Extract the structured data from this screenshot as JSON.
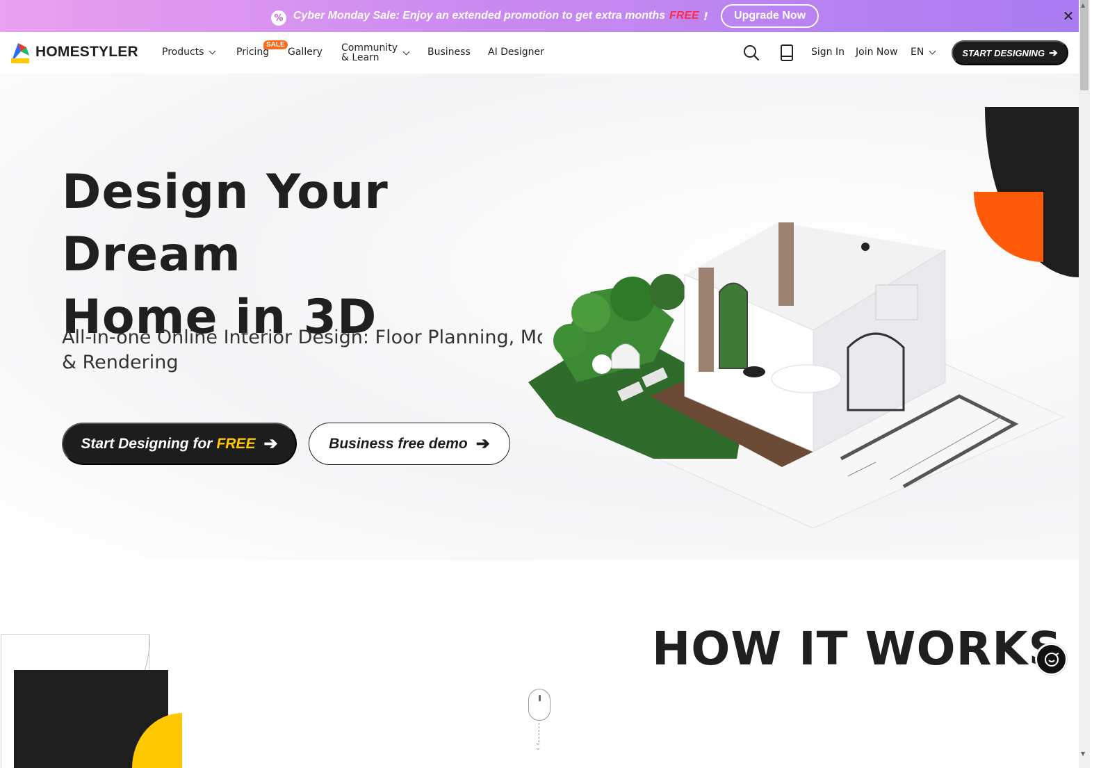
{
  "promo": {
    "icon": "percent-badge-icon",
    "text": "Cyber Monday Sale: Enjoy an extended promotion to get extra months",
    "highlight": "FREE",
    "suffix": "!",
    "button": "Upgrade Now",
    "close_icon": "close-icon"
  },
  "nav": {
    "logo_text": "HOMESTYLER",
    "products": "Products",
    "pricing": "Pricing",
    "sale_badge": "SALE",
    "gallery": "Gallery",
    "community_line1": "Community",
    "community_line2": "& Learn",
    "business": "Business",
    "ai_designer": "AI Designer",
    "sign_in": "Sign In",
    "join_now": "Join Now",
    "language": "EN",
    "start_button": "START DESIGNING"
  },
  "hero": {
    "title_line1": "Design Your Dream",
    "title_line2": "Home in 3D",
    "subtitle_line1": "All-in-one Online Interior Design: Floor Planning, Modeling",
    "subtitle_line2": "& Rendering",
    "cta_primary": "Start Designing for",
    "cta_primary_highlight": "FREE",
    "cta_secondary": "Business free demo"
  },
  "section": {
    "how_it_works": "HOW IT WORKS"
  },
  "colors": {
    "accent_orange": "#ff5a0a",
    "accent_yellow": "#ffc800",
    "dark": "#1e1e1e",
    "promo_free": "#ff2b4a"
  }
}
